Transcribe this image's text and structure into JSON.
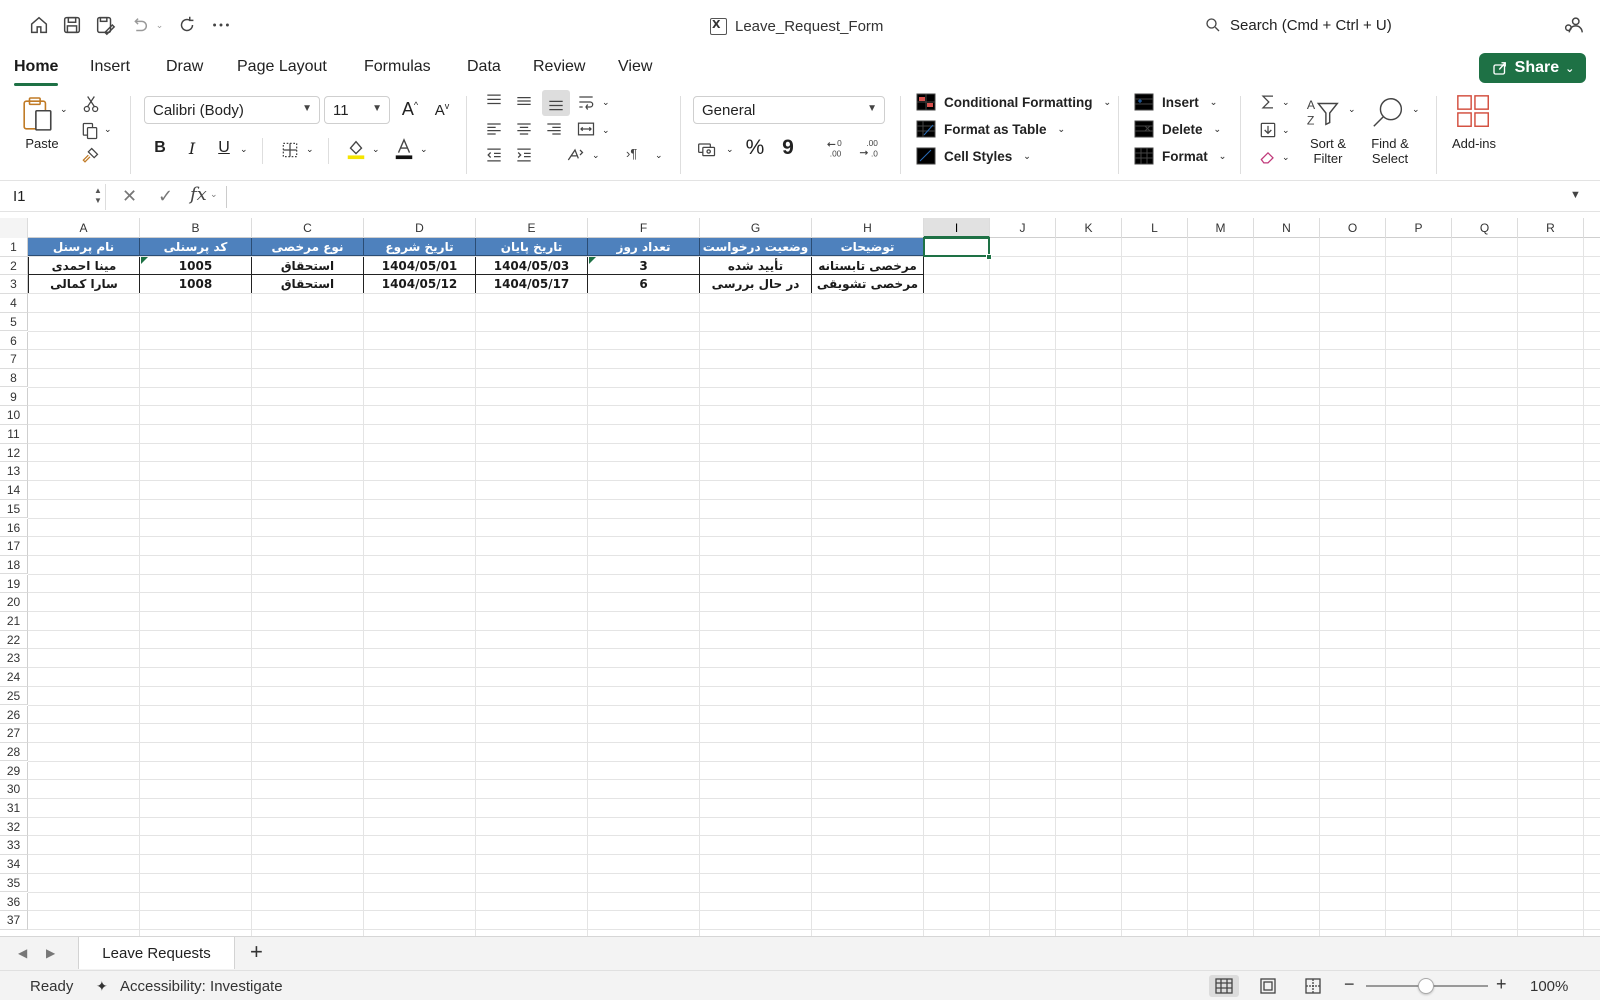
{
  "window": {
    "title": "Leave_Request_Form"
  },
  "search": {
    "placeholder": "Search (Cmd + Ctrl + U)"
  },
  "tabs": [
    "Home",
    "Insert",
    "Draw",
    "Page Layout",
    "Formulas",
    "Data",
    "Review",
    "View"
  ],
  "active_tab": "Home",
  "share_label": "Share",
  "ribbon": {
    "paste_label": "Paste",
    "font_name": "Calibri (Body)",
    "font_size": "11",
    "bold": "B",
    "italic": "I",
    "underline": "U",
    "number_format": "General",
    "percent": "%",
    "comma": "9",
    "conditional_formatting": "Conditional Formatting",
    "format_as_table": "Format as Table",
    "cell_styles": "Cell Styles",
    "insert": "Insert",
    "delete": "Delete",
    "format": "Format",
    "sort_filter": [
      "Sort &",
      "Filter"
    ],
    "find_select": [
      "Find &",
      "Select"
    ],
    "addins": "Add-ins"
  },
  "formula_bar": {
    "name_box": "I1",
    "fx": "fx",
    "formula": ""
  },
  "sheet": {
    "columns": [
      "A",
      "B",
      "C",
      "D",
      "E",
      "F",
      "G",
      "H",
      "I",
      "J",
      "K",
      "L",
      "M",
      "N",
      "O",
      "P",
      "Q",
      "R"
    ],
    "selected_column": "I",
    "rows": [
      "1",
      "2",
      "3",
      "4",
      "5",
      "6",
      "7",
      "8",
      "9",
      "10",
      "11",
      "12",
      "13",
      "14",
      "15",
      "16",
      "17",
      "18",
      "19",
      "20",
      "21",
      "22",
      "23",
      "24",
      "25",
      "26",
      "27",
      "28",
      "29",
      "30",
      "31",
      "32",
      "33",
      "34",
      "35",
      "36",
      "37"
    ],
    "headers": [
      "نام پرسنل",
      "کد پرسنلی",
      "نوع مرخصی",
      "تاریخ شروع",
      "تاریخ پایان",
      "تعداد روز",
      "وضعیت درخواست",
      "توضیحات"
    ],
    "data": [
      [
        "مینا احمدی",
        "1005",
        "استحقاق",
        "1404/05/01",
        "1404/05/03",
        "3",
        "تأیید شده",
        "مرخصی تابستانه"
      ],
      [
        "سارا کمالی",
        "1008",
        "استحقاق",
        "1404/05/12",
        "1404/05/17",
        "6",
        "در حال بررسی",
        "مرخصی تشویقی"
      ]
    ],
    "header_fill": "#4e81bd",
    "accent": "#1e7145"
  },
  "sheet_tabs": [
    "Leave Requests"
  ],
  "status": {
    "ready": "Ready",
    "accessibility": "Accessibility: Investigate",
    "zoom": "100%"
  }
}
